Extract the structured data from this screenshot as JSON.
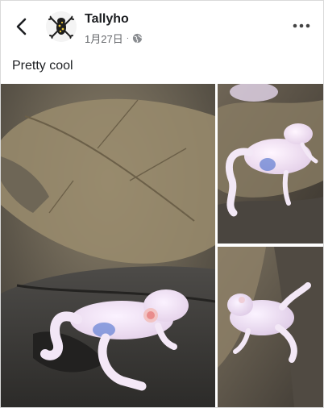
{
  "post": {
    "author": "Tallyho",
    "date": "1月27日",
    "privacy_icon": "globe-icon",
    "text": "Pretty cool"
  },
  "header": {
    "back_icon": "back-arrow-icon",
    "more_icon": "more-options-icon"
  },
  "photos": [
    {
      "subject": "glass-frog"
    },
    {
      "subject": "glass-frog"
    },
    {
      "subject": "glass-frog"
    }
  ],
  "colors": {
    "text_primary": "#1c1e21",
    "text_secondary": "#65676b"
  }
}
